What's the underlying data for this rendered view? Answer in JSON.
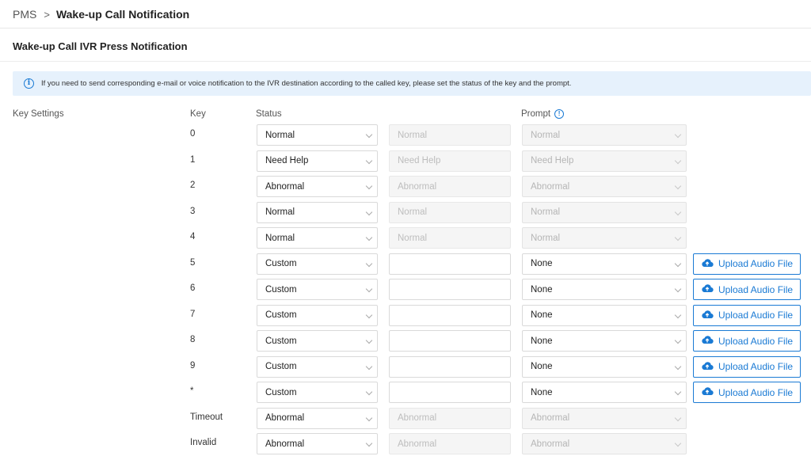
{
  "breadcrumb": {
    "parent": "PMS",
    "separator": ">",
    "current": "Wake-up Call Notification"
  },
  "section": {
    "title": "Wake-up Call IVR Press Notification"
  },
  "info": {
    "text": "If you need to send corresponding e-mail or voice notification to the IVR destination according to the called key, please set the status of the key and the prompt."
  },
  "key_settings": {
    "label": "Key Settings",
    "headers": {
      "key": "Key",
      "status": "Status",
      "prompt": "Prompt"
    },
    "upload_label": "Upload Audio File",
    "rows": [
      {
        "key": "0",
        "status": "Normal",
        "text": "Normal",
        "prompt": "Normal"
      },
      {
        "key": "1",
        "status": "Need Help",
        "text": "Need Help",
        "prompt": "Need Help"
      },
      {
        "key": "2",
        "status": "Abnormal",
        "text": "Abnormal",
        "prompt": "Abnormal"
      },
      {
        "key": "3",
        "status": "Normal",
        "text": "Normal",
        "prompt": "Normal"
      },
      {
        "key": "4",
        "status": "Normal",
        "text": "Normal",
        "prompt": "Normal"
      },
      {
        "key": "5",
        "status": "Custom",
        "text": "",
        "prompt": "None"
      },
      {
        "key": "6",
        "status": "Custom",
        "text": "",
        "prompt": "None"
      },
      {
        "key": "7",
        "status": "Custom",
        "text": "",
        "prompt": "None"
      },
      {
        "key": "8",
        "status": "Custom",
        "text": "",
        "prompt": "None"
      },
      {
        "key": "9",
        "status": "Custom",
        "text": "",
        "prompt": "None"
      },
      {
        "key": "*",
        "status": "Custom",
        "text": "",
        "prompt": "None"
      },
      {
        "key": "Timeout",
        "status": "Abnormal",
        "text": "Abnormal",
        "prompt": "Abnormal"
      },
      {
        "key": "Invalid",
        "status": "Abnormal",
        "text": "Abnormal",
        "prompt": "Abnormal"
      }
    ]
  },
  "colors": {
    "accent": "#1a7ad4",
    "info_bg": "#e6f1fc",
    "disabled_bg": "#f5f5f5"
  }
}
